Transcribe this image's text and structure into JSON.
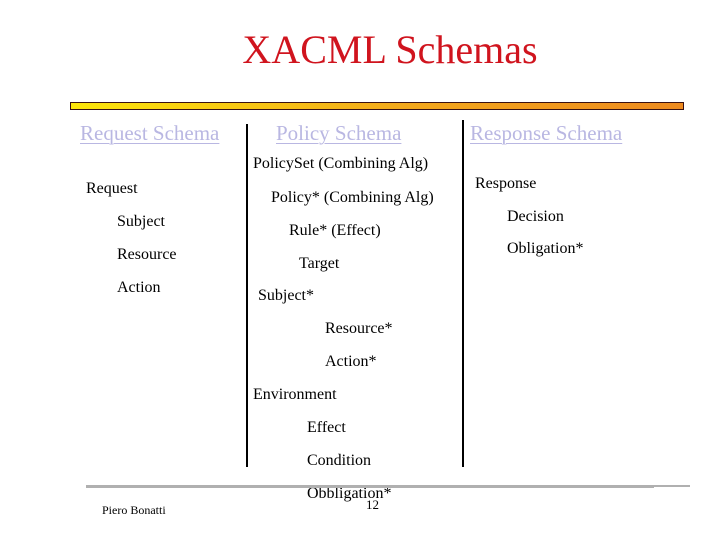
{
  "slide": {
    "title": "XACML Schemas",
    "columns": {
      "request": {
        "heading": "Request Schema",
        "items": [
          "Request",
          "Subject",
          "Resource",
          "Action"
        ]
      },
      "policy": {
        "heading": "Policy Schema",
        "items": [
          "PolicySet (Combining Alg)",
          "Policy* (Combining Alg)",
          "Rule* (Effect)",
          "Target",
          "Subject*",
          "Resource*",
          "Action*",
          "Environment",
          "Effect",
          "Condition",
          "Obbligation*"
        ]
      },
      "response": {
        "heading": "Response Schema",
        "items": [
          "Response",
          "Decision",
          "Obligation*"
        ]
      }
    },
    "footer": {
      "author": "Piero Bonatti",
      "page_number": "12"
    },
    "colors": {
      "title": "#d0141e",
      "heading": "#b9b7e2",
      "bar_start": "#fde60a",
      "bar_end": "#ee8a1e"
    }
  }
}
